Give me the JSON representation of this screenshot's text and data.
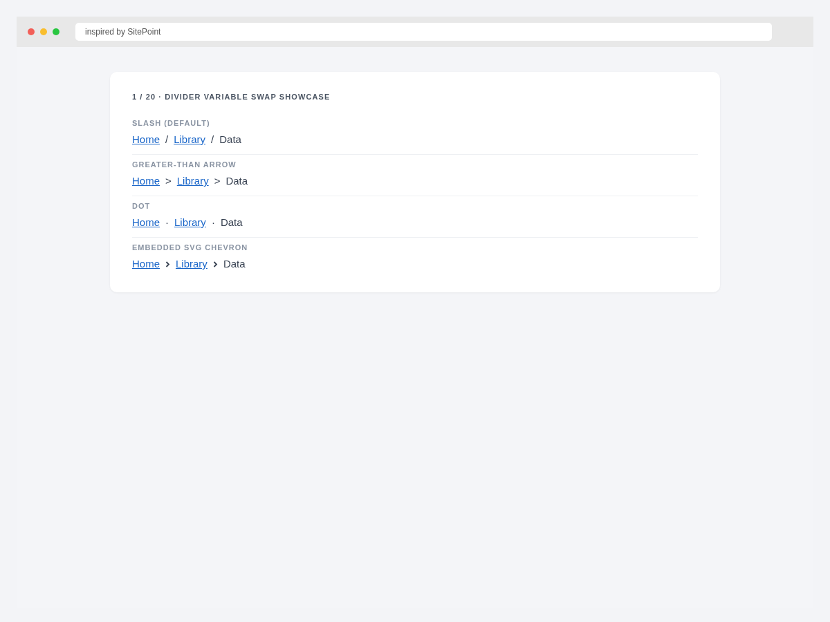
{
  "browser": {
    "address": "inspired by SitePoint"
  },
  "card": {
    "title": "1 / 20 · DIVIDER VARIABLE SWAP SHOWCASE",
    "sections": [
      {
        "label": "SLASH (DEFAULT)",
        "crumbs": [
          {
            "kind": "link",
            "text": "Home"
          },
          {
            "kind": "separator",
            "text": "/"
          },
          {
            "kind": "link",
            "text": "Library"
          },
          {
            "kind": "separator",
            "text": "/"
          },
          {
            "kind": "current",
            "text": "Data"
          }
        ]
      },
      {
        "label": "GREATER-THAN ARROW",
        "crumbs": [
          {
            "kind": "link",
            "text": "Home"
          },
          {
            "kind": "separator",
            "text": ">"
          },
          {
            "kind": "link",
            "text": "Library"
          },
          {
            "kind": "separator",
            "text": ">"
          },
          {
            "kind": "current",
            "text": "Data"
          }
        ]
      },
      {
        "label": "DOT",
        "crumbs": [
          {
            "kind": "link",
            "text": "Home"
          },
          {
            "kind": "separator",
            "text": "·"
          },
          {
            "kind": "link",
            "text": "Library"
          },
          {
            "kind": "separator",
            "text": "·"
          },
          {
            "kind": "current",
            "text": "Data"
          }
        ]
      },
      {
        "label": "EMBEDDED SVG CHEVRON",
        "crumbs": [
          {
            "kind": "link",
            "text": "Home"
          },
          {
            "kind": "chevron"
          },
          {
            "kind": "link",
            "text": "Library"
          },
          {
            "kind": "chevron"
          },
          {
            "kind": "current",
            "text": "Data"
          }
        ]
      }
    ]
  }
}
